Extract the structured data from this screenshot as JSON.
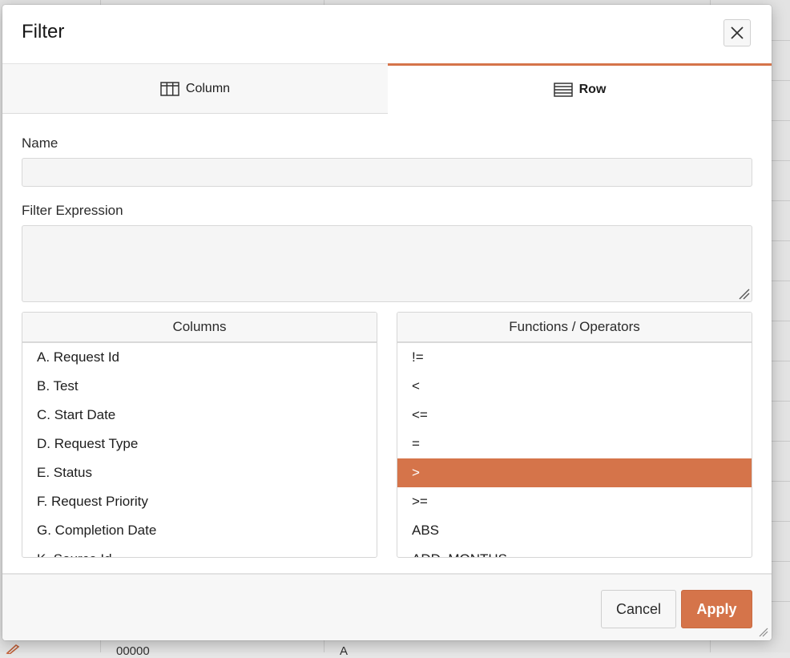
{
  "dialog": {
    "title": "Filter",
    "close_icon": "close-icon"
  },
  "tabs": [
    {
      "label": "Column",
      "icon": "table-columns-icon",
      "active": false
    },
    {
      "label": "Row",
      "icon": "table-rows-icon",
      "active": true
    }
  ],
  "fields": {
    "name_label": "Name",
    "name_value": "",
    "expression_label": "Filter Expression",
    "expression_value": ""
  },
  "columns_panel": {
    "header": "Columns",
    "items": [
      "A. Request Id",
      "B. Test",
      "C. Start Date",
      "D. Request Type",
      "E. Status",
      "F. Request Priority",
      "G. Completion Date",
      "K. Source Id"
    ]
  },
  "operators_panel": {
    "header": "Functions / Operators",
    "items": [
      "!=",
      "<",
      "<=",
      "=",
      ">",
      ">=",
      "ABS",
      "ADD_MONTHS"
    ],
    "selected": ">"
  },
  "footer": {
    "cancel_label": "Cancel",
    "apply_label": "Apply"
  },
  "background": {
    "bottom_cells": [
      "00000",
      "A"
    ]
  },
  "colors": {
    "accent": "#d5744a",
    "surface": "#f7f7f7",
    "border": "#d6d6d6"
  }
}
